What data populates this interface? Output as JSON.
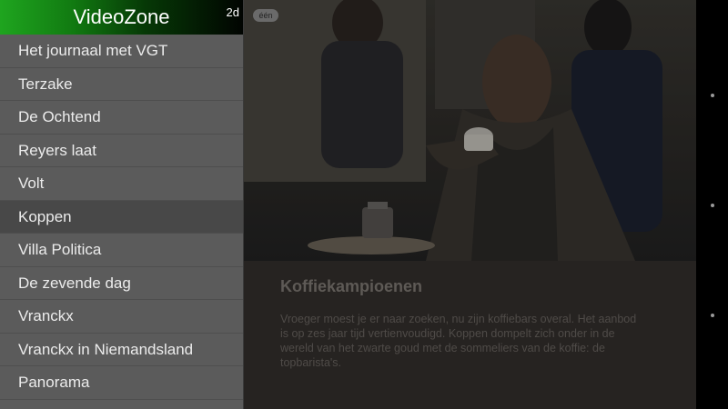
{
  "app": {
    "title": "VideoZone",
    "badge": "2d"
  },
  "menu": {
    "items": [
      {
        "label": "Het journaal met VGT"
      },
      {
        "label": "Terzake"
      },
      {
        "label": "De Ochtend"
      },
      {
        "label": "Reyers laat"
      },
      {
        "label": "Volt"
      },
      {
        "label": "Koppen",
        "selected": true
      },
      {
        "label": "Villa Politica"
      },
      {
        "label": "De zevende dag"
      },
      {
        "label": "Vranckx"
      },
      {
        "label": "Vranckx in Niemandsland"
      },
      {
        "label": "Panorama"
      }
    ]
  },
  "video": {
    "channel_logo": "één",
    "title": "Koffiekampioenen",
    "description": "Vroeger moest je er naar zoeken, nu zijn koffiebars overal. Het aanbod is op zes jaar tijd vertienvoudigd. Koppen dompelt zich onder in de wereld van het zwarte goud met de sommeliers van de koffie: de topbarista's."
  },
  "icons": {
    "system_bar": [
      "back-dot-icon",
      "home-dot-icon",
      "recents-dot-icon"
    ]
  }
}
